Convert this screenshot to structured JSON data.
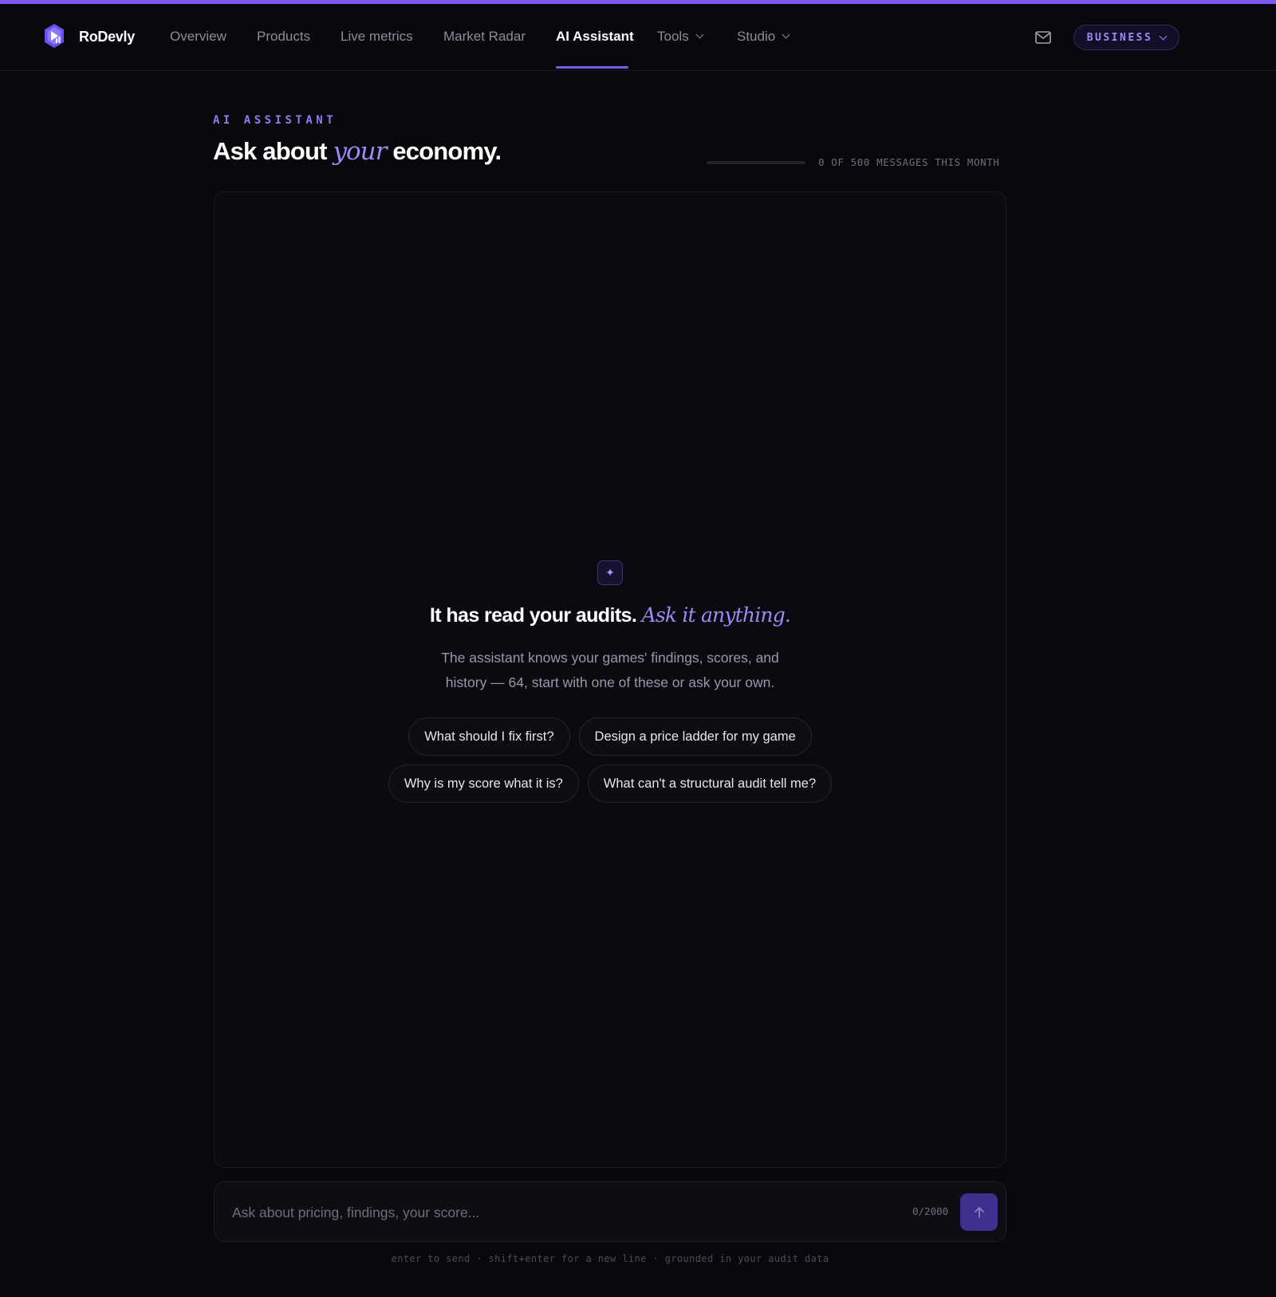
{
  "app": {
    "brand": "RoDevly",
    "accent": "#7b5cf0"
  },
  "nav": {
    "items": [
      {
        "label": "Overview",
        "active": false
      },
      {
        "label": "Products",
        "active": false
      },
      {
        "label": "Live metrics",
        "active": false
      },
      {
        "label": "Market Radar",
        "active": false
      },
      {
        "label": "AI Assistant",
        "active": true
      },
      {
        "label": "Tools",
        "active": false,
        "dropdown": true
      },
      {
        "label": "Studio",
        "active": false,
        "dropdown": true
      }
    ],
    "mail_icon": "mail-icon",
    "plan_label": "BUSINESS"
  },
  "header": {
    "eyebrow": "AI ASSISTANT",
    "title_before": "Ask about",
    "title_italic": "your",
    "title_after": "economy.",
    "usage_text": "0 OF 500 MESSAGES THIS MONTH",
    "usage_fraction": 0
  },
  "empty_state": {
    "icon": "sparkle-icon",
    "title_before": "It has read your audits.",
    "title_italic": "Ask it anything.",
    "description": "The assistant knows your games' findings, scores, and history — 64, start with one of these or ask your own.",
    "suggestions_row1": [
      "What should I fix first?",
      "Design a price ladder for my game"
    ],
    "suggestions_row2": [
      "Why is my score what it is?",
      "What can't a structural audit tell me?"
    ]
  },
  "composer": {
    "value": "",
    "placeholder": "Ask about pricing, findings, your score...",
    "counter": "0/2000",
    "send_icon": "arrow-up-icon",
    "hint": "enter to send · shift+enter for a new line · grounded in your audit data"
  }
}
